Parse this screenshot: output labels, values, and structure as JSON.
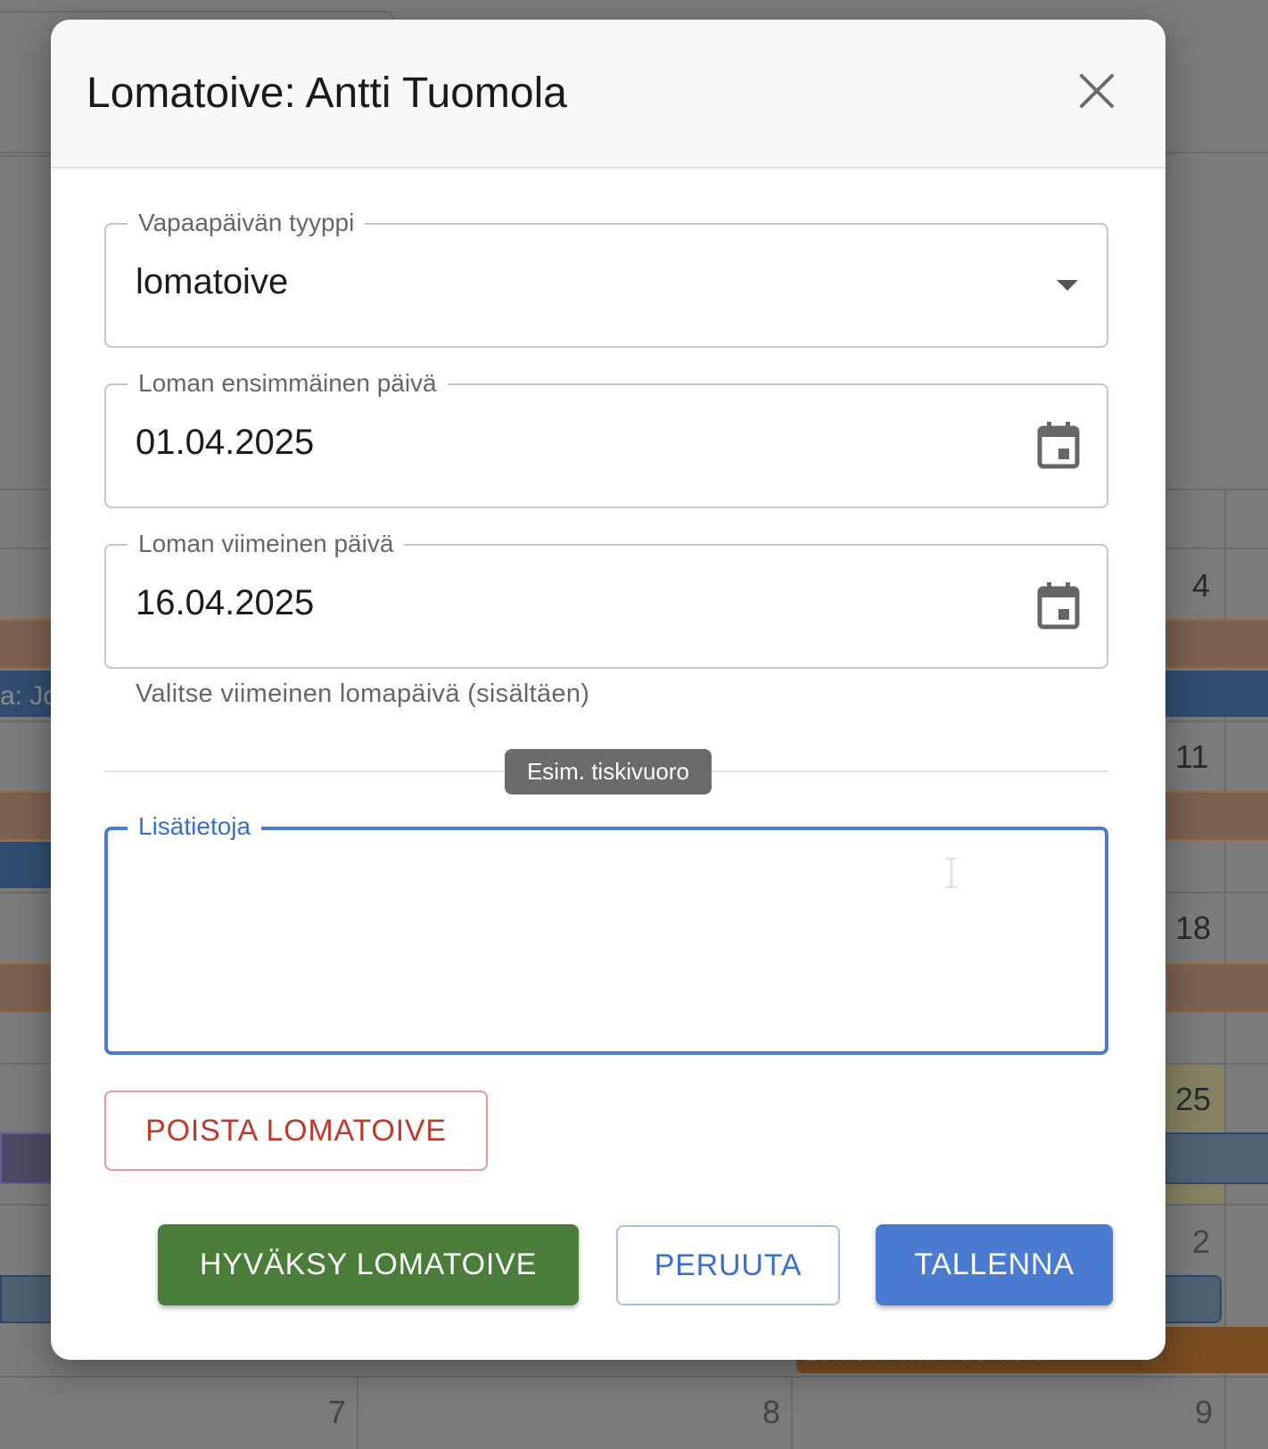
{
  "background_calendar": {
    "day_numbers": [
      "4",
      "11",
      "18",
      "25",
      "2",
      "7",
      "8",
      "9"
    ],
    "event_labels": [
      "a: Jo",
      "Loma: Antti Tuomola"
    ]
  },
  "dialog": {
    "title": "Lomatoive: Antti Tuomola",
    "close_icon": "close-icon",
    "type_field": {
      "label": "Vapaapäivän tyyppi",
      "value": "lomatoive",
      "icon": "dropdown-arrow-icon"
    },
    "start_date_field": {
      "label": "Loman ensimmäinen päivä",
      "value": "01.04.2025",
      "icon": "calendar-icon"
    },
    "end_date_field": {
      "label": "Loman viimeinen päivä",
      "value": "16.04.2025",
      "icon": "calendar-icon",
      "helper_text": "Valitse viimeinen lomapäivä (sisältäen)"
    },
    "tooltip": "Esim. tiskivuoro",
    "notes_field": {
      "label": "Lisätietoja",
      "value": ""
    },
    "buttons": {
      "delete": "POISTA LOMATOIVE",
      "approve": "HYVÄKSY LOMATOIVE",
      "cancel": "PERUUTA",
      "save": "TALLENNA"
    }
  },
  "colors": {
    "primary": "#4a7bd0",
    "approve": "#4a7d3a",
    "danger": "#c0392b"
  }
}
